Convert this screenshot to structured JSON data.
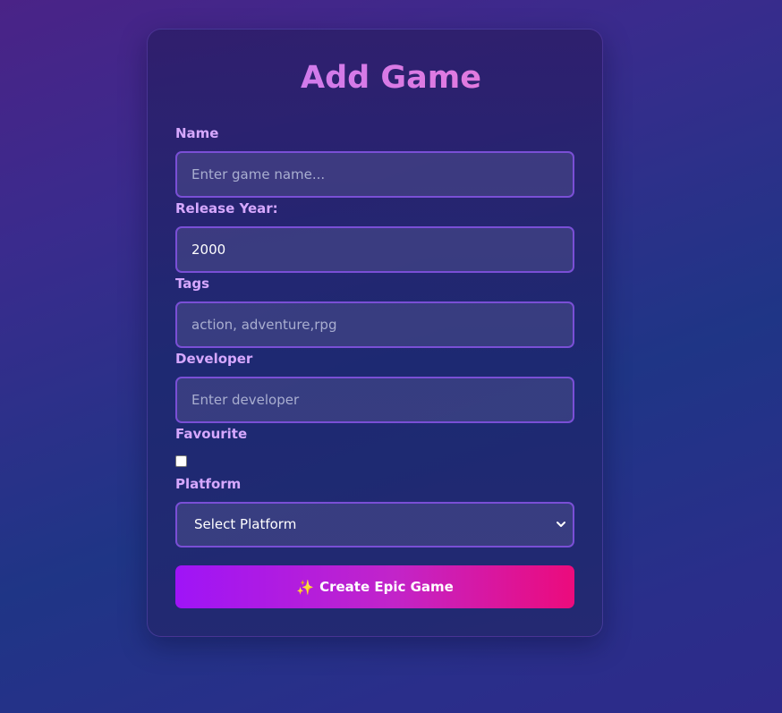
{
  "form": {
    "title": "Add Game",
    "name": {
      "label": "Name",
      "placeholder": "Enter game name..."
    },
    "release_year": {
      "label": "Release Year:",
      "value": "2000"
    },
    "tags": {
      "label": "Tags",
      "placeholder": "action, adventure,rpg"
    },
    "developer": {
      "label": "Developer",
      "placeholder": "Enter developer"
    },
    "favourite": {
      "label": "Favourite",
      "checked": false
    },
    "platform": {
      "label": "Platform",
      "selected": "Select Platform"
    },
    "submit": {
      "icon": "sparkles-icon",
      "label": "Create Epic Game"
    }
  },
  "colors": {
    "accent_purple": "#9f14f7",
    "accent_pink": "#ec0b7c",
    "label": "#d6a8ff",
    "field_border": "#7a4fd6"
  }
}
